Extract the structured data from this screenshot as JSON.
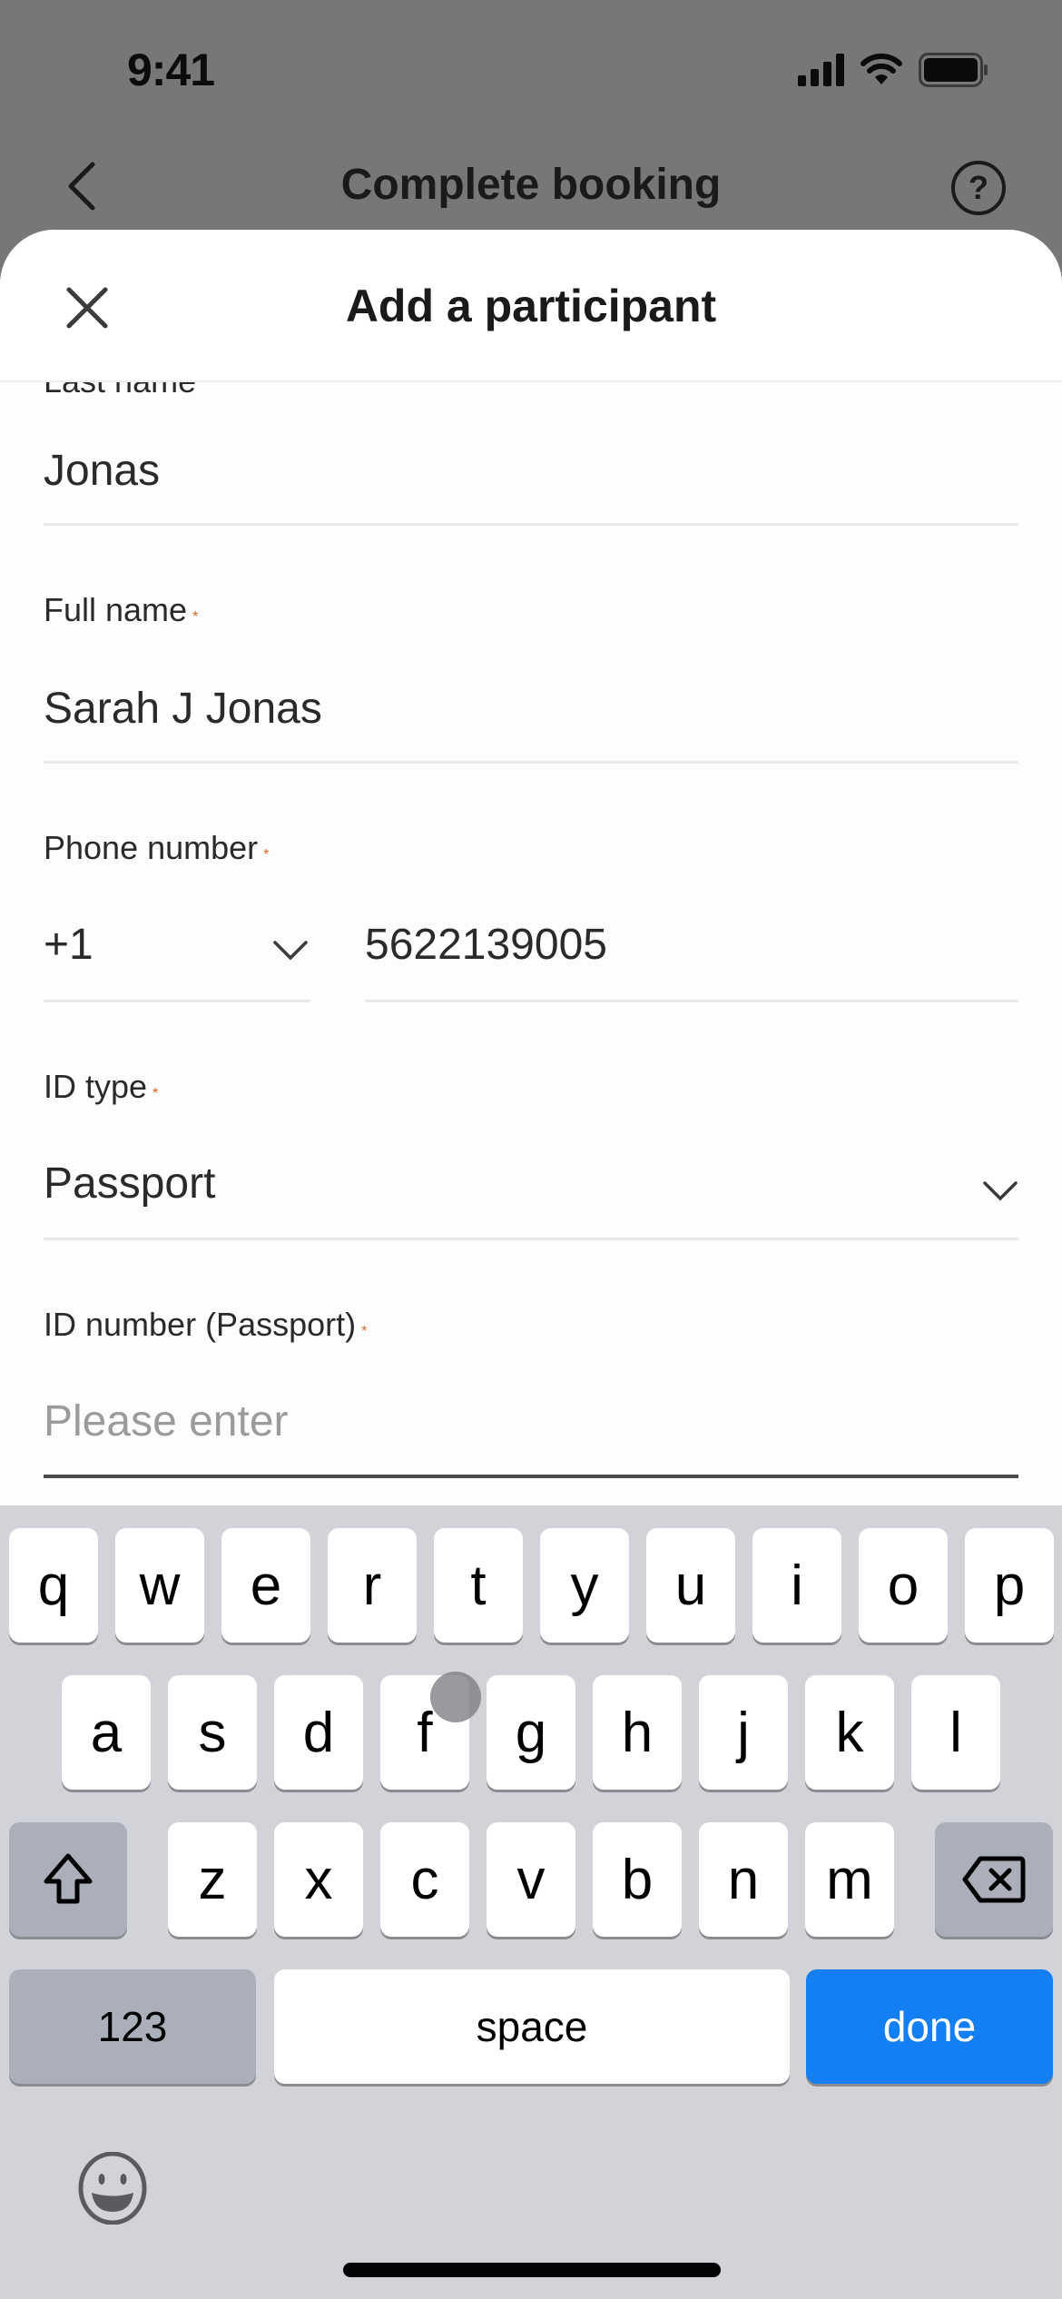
{
  "status_bar": {
    "time": "9:41"
  },
  "nav": {
    "title": "Complete booking",
    "back_icon": "chevron-left-icon",
    "help_icon": "question-circle-icon",
    "help_glyph": "?"
  },
  "sheet": {
    "title": "Add a participant",
    "close_icon": "close-icon",
    "fields": {
      "last_name": {
        "label": "Last name",
        "value": "Jonas"
      },
      "full_name": {
        "label": "Full name",
        "required_mark": "*",
        "value": "Sarah J Jonas"
      },
      "phone": {
        "label": "Phone number",
        "required_mark": "*",
        "country_code": "+1",
        "number": "5622139005"
      },
      "id_type": {
        "label": "ID type",
        "required_mark": "*",
        "value": "Passport"
      },
      "id_number": {
        "label": "ID number (Passport)",
        "required_mark": "*",
        "value": "",
        "placeholder": "Please enter"
      }
    }
  },
  "colors": {
    "required": "#e0631e",
    "done_key": "#147ef5",
    "keyboard_bg": "#d1d3d9"
  },
  "keyboard": {
    "row1": [
      "q",
      "w",
      "e",
      "r",
      "t",
      "y",
      "u",
      "i",
      "o",
      "p"
    ],
    "row2": [
      "a",
      "s",
      "d",
      "f",
      "g",
      "h",
      "j",
      "k",
      "l"
    ],
    "row3": [
      "z",
      "x",
      "c",
      "v",
      "b",
      "n",
      "m"
    ],
    "shift_icon": "shift-icon",
    "delete_icon": "backspace-icon",
    "numbers_label": "123",
    "space_label": "space",
    "done_label": "done",
    "emoji_icon": "emoji-icon"
  }
}
